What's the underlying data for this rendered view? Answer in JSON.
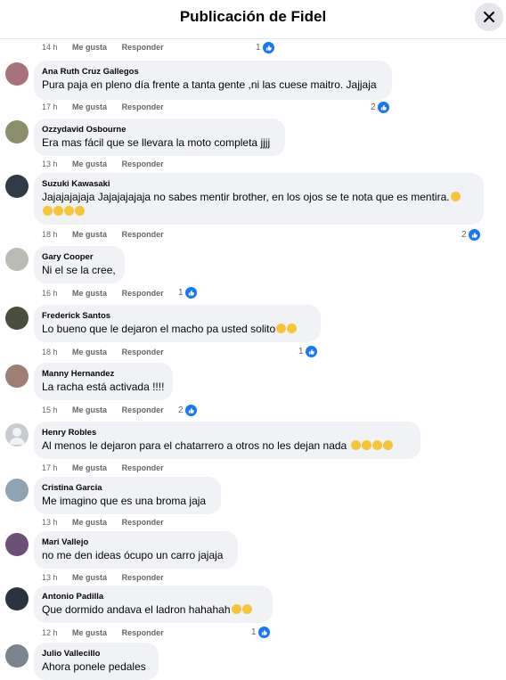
{
  "header": {
    "title": "Publicación de Fidel"
  },
  "actions": {
    "like": "Me gusta",
    "reply": "Responder"
  },
  "top_meta": {
    "time": "14 h",
    "reactions": "1"
  },
  "comments": [
    {
      "author": "Ana Ruth Cruz Gallegos",
      "text": "Pura paja en pleno día frente a tanta gente ,ni las cuese maitro. Jajjaja",
      "time": "17 h",
      "reactions": "2",
      "avatar_color": "#a8727a"
    },
    {
      "author": "Ozzydavid Osbourne",
      "text": "Era mas fácil que se llevara la moto completa jjjj",
      "time": "13 h",
      "reactions": "",
      "avatar_color": "#8a8f6a"
    },
    {
      "author": "Suzuki Kawasaki",
      "text": "Jajajajajaja Jajajajajaja no sabes mentir brother, en los ojos se te nota que es mentira.",
      "time": "18 h",
      "reactions": "2",
      "avatar_color": "#2f3a46"
    },
    {
      "author": "Gary Cooper",
      "text": "Ni el se la cree,",
      "time": "16 h",
      "reactions": "1",
      "avatar_color": "#b9bcb5"
    },
    {
      "author": "Frederick Santos",
      "text": "Lo bueno que le dejaron el macho pa usted solito",
      "time": "18 h",
      "reactions": "1",
      "avatar_color": "#4a4f3d"
    },
    {
      "author": "Manny Hernandez",
      "text": "La racha está activada !!!!",
      "time": "15 h",
      "reactions": "2",
      "avatar_color": "#9c7e73"
    },
    {
      "author": "Henry Robles",
      "text": "Al menos le dejaron para el chatarrero a otros no les dejan nada",
      "time": "17 h",
      "reactions": "",
      "avatar_color": "#c8ccd1"
    },
    {
      "author": "Cristina Garcia",
      "text": "Me imagino que es una broma jaja",
      "time": "13 h",
      "reactions": "",
      "avatar_color": "#8fa3b5"
    },
    {
      "author": "Mari Vallejo",
      "text": "no me den ideas ócupo un carro jajaja",
      "time": "13 h",
      "reactions": "",
      "avatar_color": "#6d4f7a"
    },
    {
      "author": "Antonio Padilla",
      "text": "Que dormido andava el ladron hahahah",
      "time": "12 h",
      "reactions": "1",
      "avatar_color": "#2c3340"
    },
    {
      "author": "Julio Vallecillo",
      "text": "Ahora ponele pedales",
      "time": "",
      "reactions": "",
      "avatar_color": "#7a8590"
    }
  ]
}
